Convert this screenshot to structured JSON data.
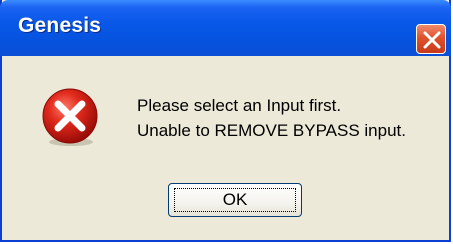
{
  "dialog": {
    "title": "Genesis",
    "close_icon": "close-icon",
    "message_icon": "error-icon",
    "message_lines": [
      "Please select an Input first.",
      "Unable to REMOVE BYPASS input."
    ],
    "ok_label": "OK"
  },
  "colors": {
    "titlebar": "#0a58e8",
    "close_button": "#e0512b",
    "background": "#ece9d8",
    "error_icon": "#d42020"
  }
}
